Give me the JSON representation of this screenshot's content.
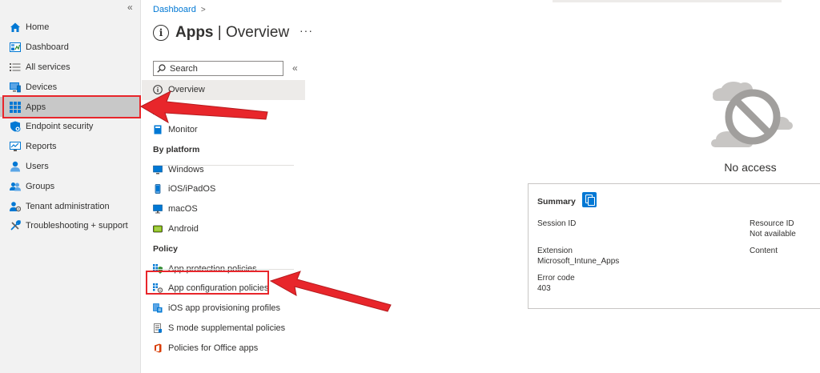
{
  "leftnav": {
    "collapse_glyph": "«",
    "items": [
      {
        "label": "Home",
        "icon": "home-icon"
      },
      {
        "label": "Dashboard",
        "icon": "dashboard-icon"
      },
      {
        "label": "All services",
        "icon": "list-icon"
      },
      {
        "label": "Devices",
        "icon": "devices-icon"
      },
      {
        "label": "Apps",
        "icon": "apps-grid-icon",
        "selected": true
      },
      {
        "label": "Endpoint security",
        "icon": "shield-icon"
      },
      {
        "label": "Reports",
        "icon": "reports-icon"
      },
      {
        "label": "Users",
        "icon": "user-icon"
      },
      {
        "label": "Groups",
        "icon": "groups-icon"
      },
      {
        "label": "Tenant administration",
        "icon": "tenant-admin-icon"
      },
      {
        "label": "Troubleshooting + support",
        "icon": "wrench-icon"
      }
    ]
  },
  "breadcrumb": {
    "items": [
      "Dashboard"
    ],
    "separator": ">"
  },
  "header": {
    "title": "Apps",
    "separator": "|",
    "subtitle": "Overview",
    "more": "···",
    "info_glyph": "i"
  },
  "search": {
    "placeholder": "Search",
    "collapse_glyph": "«"
  },
  "menu": {
    "top": [
      {
        "label": "Overview",
        "icon": "info-icon",
        "selected": true
      },
      {
        "label": "All apps",
        "icon": "all-apps-icon"
      },
      {
        "label": "Monitor",
        "icon": "monitor-book-icon"
      }
    ],
    "by_platform_label": "By platform",
    "by_platform": [
      {
        "label": "Windows",
        "icon": "windows-monitor-icon"
      },
      {
        "label": "iOS/iPadOS",
        "icon": "phone-icon"
      },
      {
        "label": "macOS",
        "icon": "mac-monitor-icon"
      },
      {
        "label": "Android",
        "icon": "android-tablet-icon"
      }
    ],
    "policy_label": "Policy",
    "policy": [
      {
        "label": "App protection policies",
        "icon": "app-protection-icon"
      },
      {
        "label": "App configuration policies",
        "icon": "app-config-icon"
      },
      {
        "label": "iOS app provisioning profiles",
        "icon": "provisioning-icon"
      },
      {
        "label": "S mode supplemental policies",
        "icon": "doc-policy-icon"
      },
      {
        "label": "Policies for Office apps",
        "icon": "office-icon"
      }
    ]
  },
  "noaccess": {
    "text": "No access"
  },
  "summary": {
    "title": "Summary",
    "session_id_label": "Session ID",
    "resource_id_label": "Resource ID",
    "resource_id_value": "Not available",
    "extension_label": "Extension",
    "extension_value": "Microsoft_Intune_Apps",
    "content_label": "Content",
    "error_code_label": "Error code",
    "error_code_value": "403"
  },
  "colors": {
    "accent": "#0078d4",
    "highlight": "#e8262b",
    "nav_bg": "#f2f2f2",
    "selected": "#c8c8c8"
  }
}
